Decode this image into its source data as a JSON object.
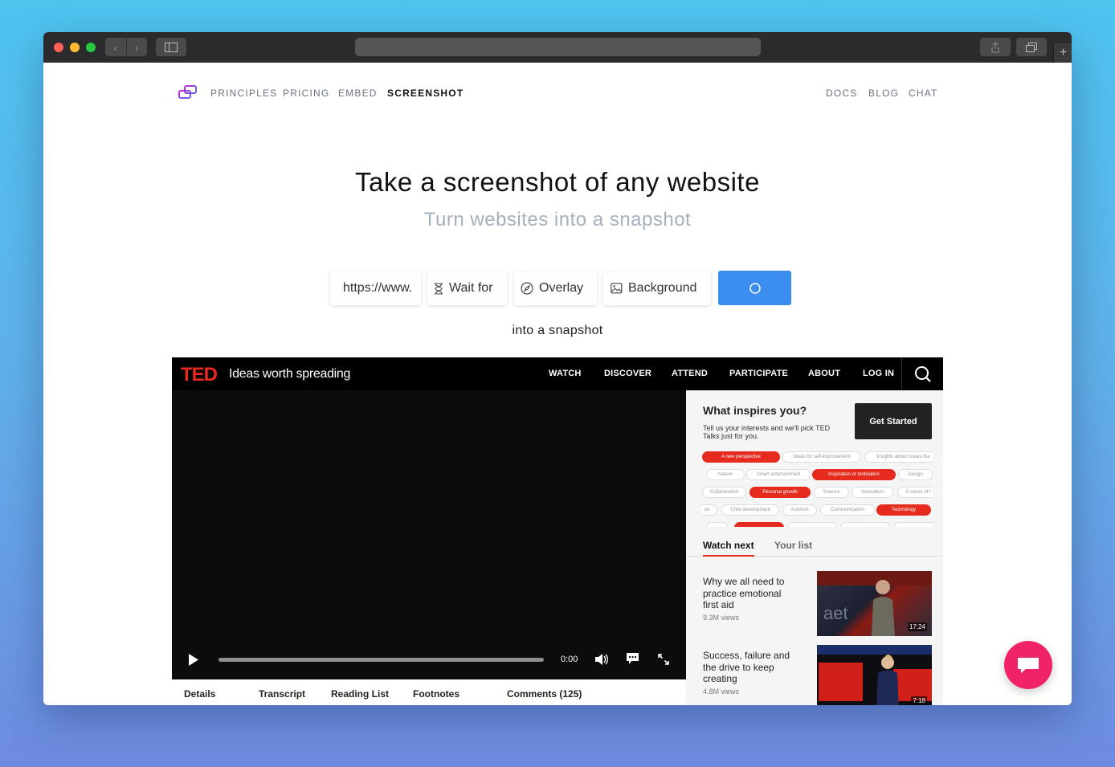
{
  "colors": {
    "accent": "#3b8ef0",
    "ted_red": "#e62b1e",
    "chat_bubble": "#f0236a"
  },
  "site_nav": {
    "left": [
      "PRINCIPLES",
      "PRICING",
      "EMBED",
      "SCREENSHOT"
    ],
    "right": [
      "DOCS",
      "BLOG",
      "CHAT"
    ],
    "active": "SCREENSHOT"
  },
  "hero": {
    "title": "Take a screenshot of any website",
    "subtitle": "Turn websites into a snapshot"
  },
  "form": {
    "url_value": "https://www.",
    "wait_for_label": "Wait for",
    "overlay_label": "Overlay",
    "background_label": "Background",
    "submit_icon": "circle-spinner-icon"
  },
  "caption": "into a snapshot",
  "screenshot": {
    "header": {
      "logo": "TED",
      "tagline": "Ideas worth spreading",
      "nav": [
        "WATCH",
        "DISCOVER",
        "ATTEND",
        "PARTICIPATE",
        "ABOUT",
        "LOG IN"
      ]
    },
    "video": {
      "time": "0:00"
    },
    "below_tabs": [
      "Details",
      "Transcript",
      "Reading List",
      "Footnotes",
      "Comments (125)"
    ],
    "sidebar": {
      "title": "What inspires you?",
      "text": "Tell us your interests and we'll pick TED Talks just for you.",
      "cta": "Get Started",
      "chips": [
        {
          "label": "A new perspective",
          "selected": true
        },
        {
          "label": "Ideas for self-improvement",
          "selected": false
        },
        {
          "label": "Insights about issues tha",
          "selected": false
        },
        {
          "label": "Nature",
          "selected": false
        },
        {
          "label": "Smart entertainment",
          "selected": false
        },
        {
          "label": "Inspiration or motivation",
          "selected": true
        },
        {
          "label": "Design",
          "selected": false
        },
        {
          "label": "Collaboration",
          "selected": false
        },
        {
          "label": "Personal growth",
          "selected": true
        },
        {
          "label": "Science",
          "selected": false
        },
        {
          "label": "Innovation",
          "selected": false
        },
        {
          "label": "A sense of t",
          "selected": false
        },
        {
          "label": "ter",
          "selected": false
        },
        {
          "label": "Child development",
          "selected": false
        },
        {
          "label": "Activism",
          "selected": false
        },
        {
          "label": "Communication",
          "selected": false
        },
        {
          "label": "Technology",
          "selected": true
        }
      ],
      "tabs": [
        "Watch next",
        "Your list"
      ],
      "cards": [
        {
          "title": "Why we all need to practice emotional first aid",
          "views": "9.3M views",
          "duration": "17:24"
        },
        {
          "title": "Success, failure and the drive to keep creating",
          "views": "4.8M views",
          "duration": "7:18"
        }
      ]
    }
  }
}
